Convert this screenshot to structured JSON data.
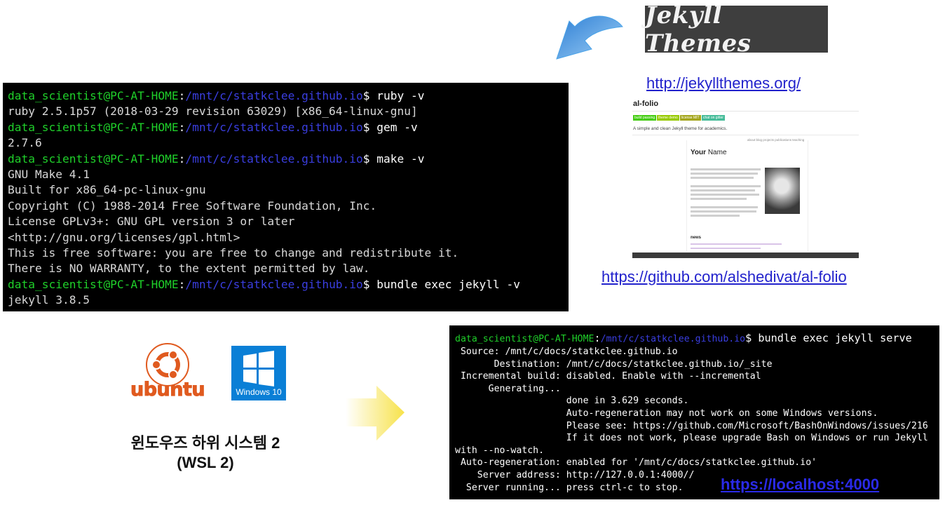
{
  "terminal1": {
    "lines": [
      {
        "user": "data_scientist@PC-AT-HOME",
        "sep": ":",
        "path": "/mnt/c/statkclee.github.io",
        "cmd": "$ ruby -v"
      },
      {
        "text": "ruby 2.5.1p57 (2018-03-29 revision 63029) [x86_64-linux-gnu]"
      },
      {
        "user": "data_scientist@PC-AT-HOME",
        "sep": ":",
        "path": "/mnt/c/statkclee.github.io",
        "cmd": "$ gem -v"
      },
      {
        "text": "2.7.6"
      },
      {
        "user": "data_scientist@PC-AT-HOME",
        "sep": ":",
        "path": "/mnt/c/statkclee.github.io",
        "cmd": "$ make -v"
      },
      {
        "text": "GNU Make 4.1"
      },
      {
        "text": "Built for x86_64-pc-linux-gnu"
      },
      {
        "text": "Copyright (C) 1988-2014 Free Software Foundation, Inc."
      },
      {
        "text": "License GPLv3+: GNU GPL version 3 or later"
      },
      {
        "text": "<http://gnu.org/licenses/gpl.html>"
      },
      {
        "text": "This is free software: you are free to change and redistribute it."
      },
      {
        "text": "There is NO WARRANTY, to the extent permitted by law."
      },
      {
        "user": "data_scientist@PC-AT-HOME",
        "sep": ":",
        "path": "/mnt/c/statkclee.github.io",
        "cmd": "$ bundle exec jekyll -v"
      },
      {
        "text": "jekyll 3.8.5"
      }
    ]
  },
  "terminal2": {
    "prompt": {
      "user": "data_scientist@PC-AT-HOME",
      "sep": ":",
      "path": "/mnt/c/statkclee.github.io",
      "cmd": "$ bundle exec jekyll serve"
    },
    "lines": [
      " Source: /mnt/c/docs/statkclee.github.io",
      "       Destination: /mnt/c/docs/statkclee.github.io/_site",
      " Incremental build: disabled. Enable with --incremental",
      "      Generating...",
      "                    done in 3.629 seconds.",
      "                    Auto-regeneration may not work on some Windows versions.",
      "                    Please see: https://github.com/Microsoft/BashOnWindows/issues/216",
      "                    If it does not work, please upgrade Bash on Windows or run Jekyll",
      "with --no-watch.",
      " Auto-regeneration: enabled for '/mnt/c/docs/statkclee.github.io'",
      "    Server address: http://127.0.0.1:4000//",
      "  Server running... press ctrl-c to stop."
    ],
    "localhost_link": "https://localhost:4000"
  },
  "jekyll_logo": {
    "text": "Jekyll Themes"
  },
  "jekyllthemes_link": "http://jekyllthemes.org/",
  "alfolio": {
    "title": "al-folio",
    "badges": [
      {
        "text": "build passing",
        "color": "#4c1"
      },
      {
        "text": "theme demo",
        "color": "#97ca00"
      },
      {
        "text": "license MIT",
        "color": "#a4a61d"
      },
      {
        "text": "chat on gitter",
        "color": "#46bc99"
      }
    ],
    "tagline": "A simple and clean Jekyll theme for academics.",
    "nav": "about  blog  projects  publications  teaching",
    "name_bold": "Your",
    "name_rest": " Name",
    "news_heading": "news"
  },
  "alfolio_link": "https://github.com/alshedivat/al-folio",
  "ubuntu": {
    "word": "ubuntu",
    "icon": "ubuntu-circle-of-friends-icon"
  },
  "windows": {
    "word": "Windows 10",
    "icon": "windows-logo-icon"
  },
  "wsl": {
    "line1": "윈도우즈 하위 시스템 2",
    "line2": "(WSL 2)"
  },
  "colors": {
    "terminal_bg": "#000000",
    "prompt_user": "#1fd02a",
    "prompt_path": "#3a3ee0",
    "link": "#2222cc",
    "arrow_blue": "#4aa3e8",
    "arrow_yellow": "#f7e24a",
    "ubuntu_orange": "#e05a1f",
    "windows_blue": "#0a7fd6"
  }
}
